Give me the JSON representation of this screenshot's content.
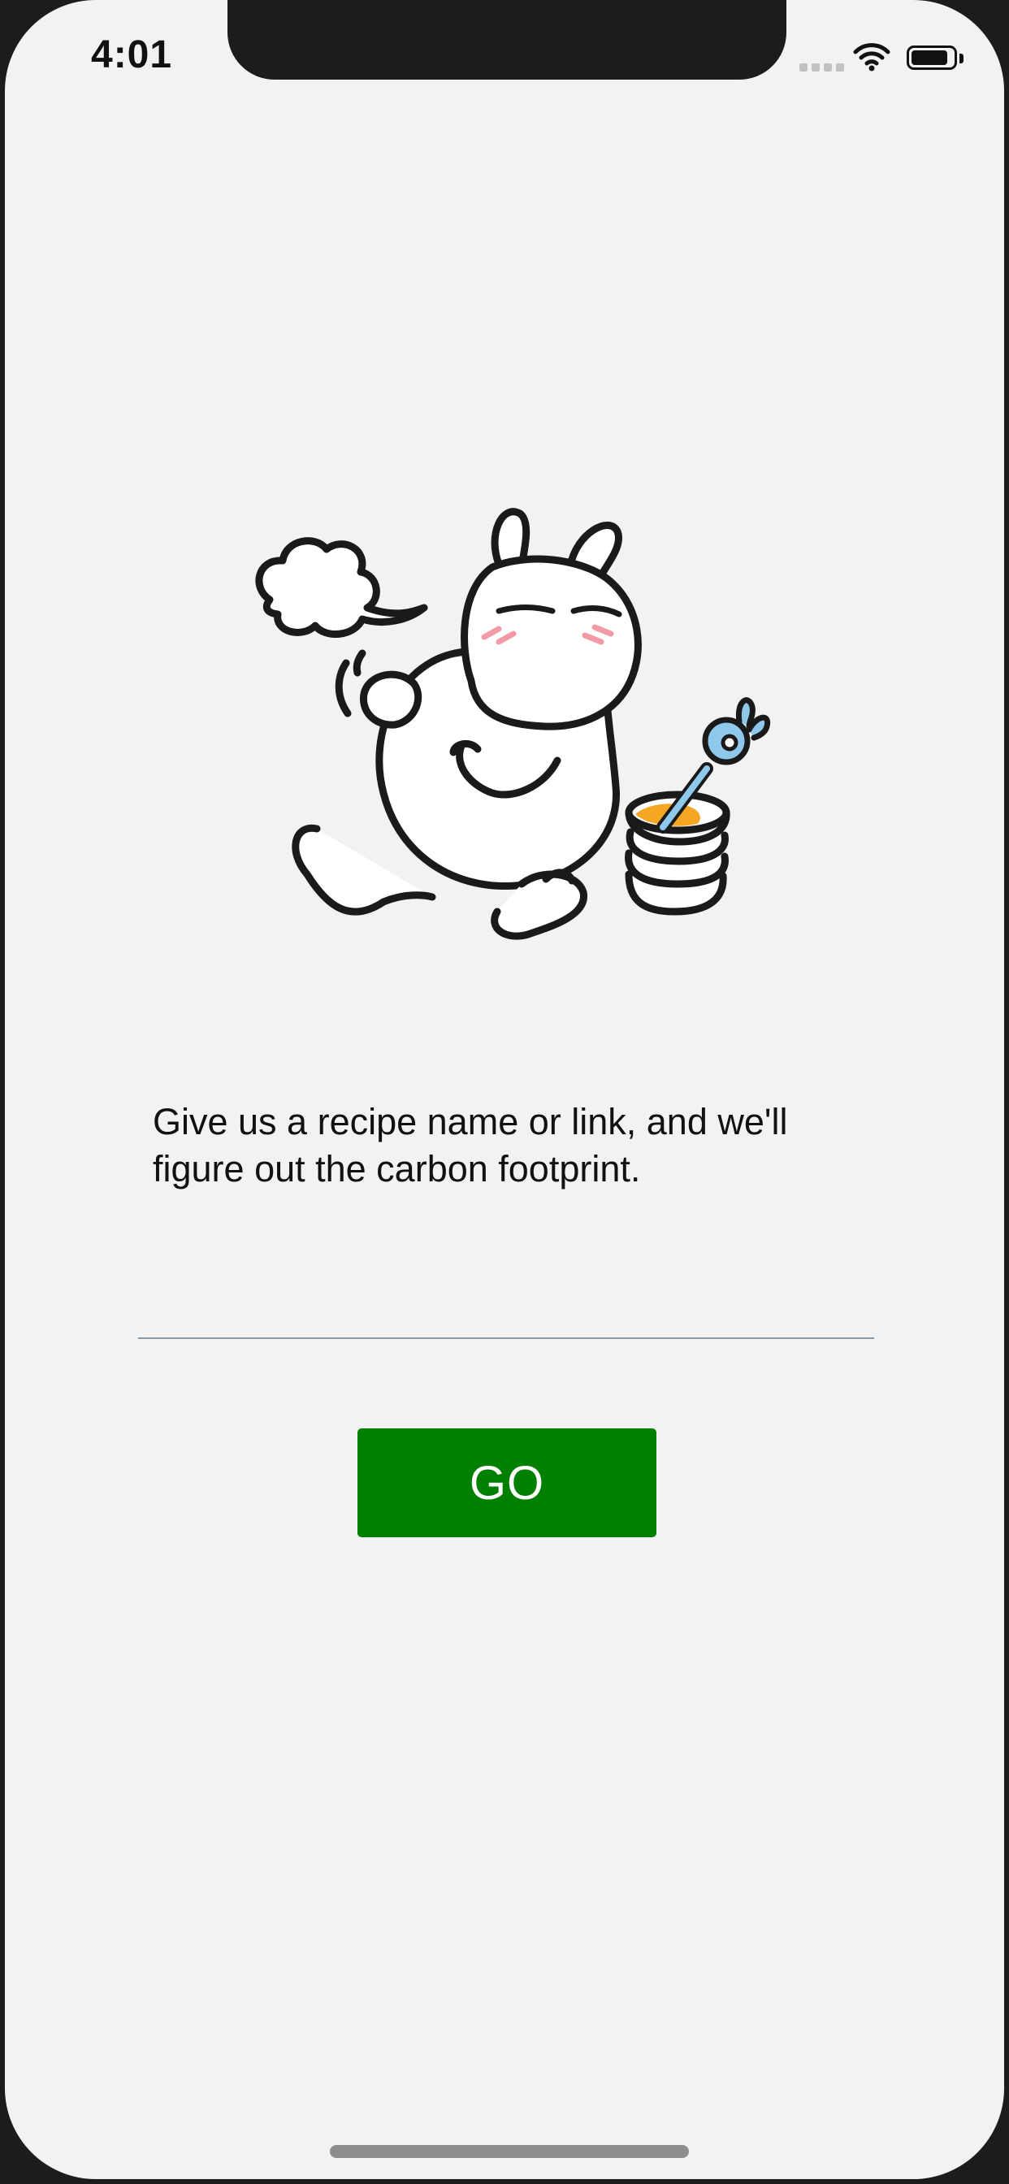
{
  "status_bar": {
    "time": "4:01",
    "icons": [
      "signal-icon",
      "wifi-icon",
      "battery-icon"
    ]
  },
  "illustration": {
    "icon": "sleepy-bunny-illustration"
  },
  "main": {
    "prompt": "Give us a recipe name or link, and we'll figure out the carbon footprint.",
    "input_value": "",
    "go_label": "GO"
  },
  "colors": {
    "background": "#f2f2f2",
    "button": "#007f00",
    "button_text": "#ffffff",
    "underline": "#8a99a6"
  }
}
